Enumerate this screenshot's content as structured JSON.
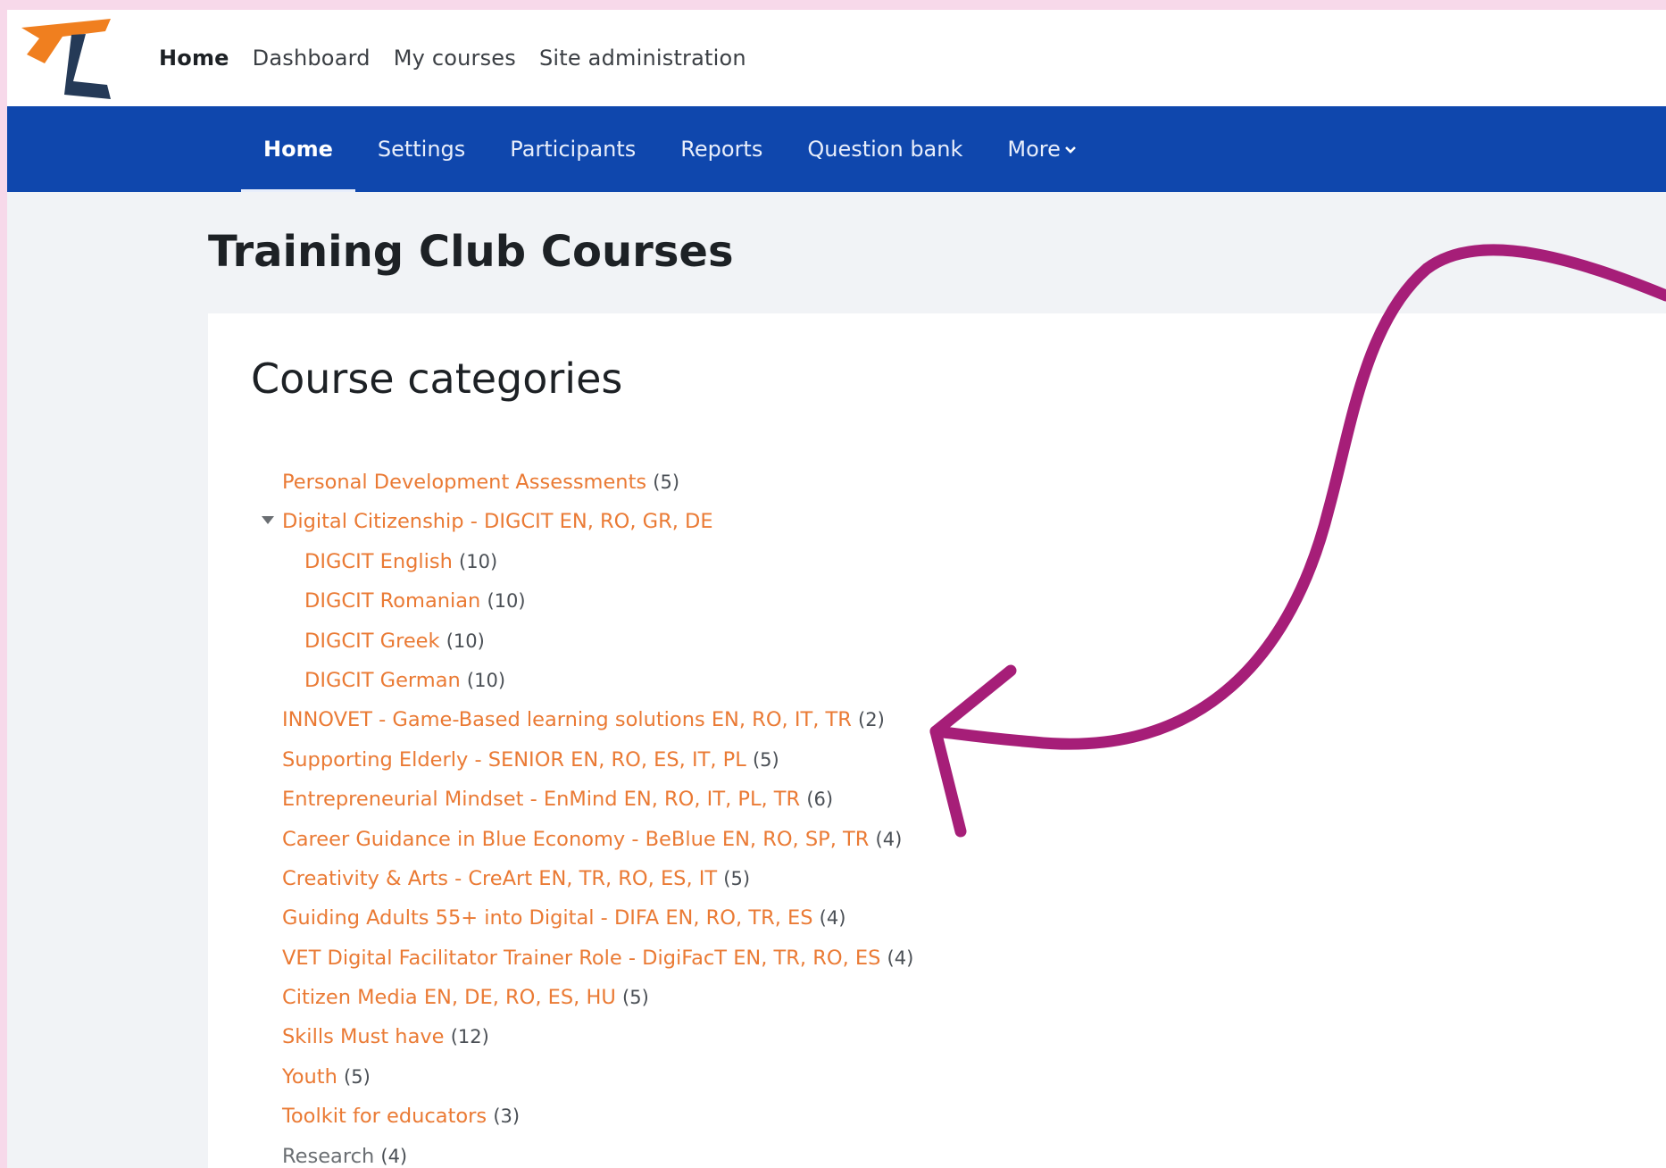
{
  "colors": {
    "primary": "#0f47ad",
    "link": "#ea7a34",
    "logo_orange": "#f07f1f",
    "logo_navy": "#253a57",
    "annotation_arrow": "#a61e78"
  },
  "topnav": {
    "items": [
      {
        "label": "Home",
        "active": true
      },
      {
        "label": "Dashboard"
      },
      {
        "label": "My courses"
      },
      {
        "label": "Site administration"
      }
    ]
  },
  "secondary_nav": {
    "items": [
      {
        "label": "Home",
        "active": true
      },
      {
        "label": "Settings"
      },
      {
        "label": "Participants"
      },
      {
        "label": "Reports"
      },
      {
        "label": "Question bank"
      },
      {
        "label": "More",
        "icon": "chevron-down-icon"
      }
    ]
  },
  "page": {
    "title": "Training Club Courses"
  },
  "course_categories": {
    "heading": "Course categories",
    "items": [
      {
        "name": "Personal Development Assessments",
        "count": "(5)"
      },
      {
        "name": "Digital Citizenship - DIGCIT EN, RO, GR, DE",
        "count": "",
        "expanded": true
      },
      {
        "name": "DIGCIT English",
        "count": "(10)"
      },
      {
        "name": "DIGCIT Romanian",
        "count": "(10)"
      },
      {
        "name": "DIGCIT Greek",
        "count": "(10)"
      },
      {
        "name": "DIGCIT German",
        "count": "(10)"
      },
      {
        "name": "INNOVET - Game-Based learning solutions EN, RO, IT, TR",
        "count": "(2)"
      },
      {
        "name": "Supporting Elderly - SENIOR EN, RO, ES, IT, PL",
        "count": "(5)"
      },
      {
        "name": "Entrepreneurial Mindset - EnMind EN, RO, IT, PL, TR",
        "count": "(6)"
      },
      {
        "name": "Career Guidance in Blue Economy - BeBlue EN, RO, SP, TR",
        "count": "(4)"
      },
      {
        "name": "Creativity & Arts - CreArt EN, TR, RO, ES, IT",
        "count": "(5)"
      },
      {
        "name": "Guiding Adults 55+ into Digital - DIFA EN, RO, TR, ES",
        "count": "(4)"
      },
      {
        "name": "VET Digital Facilitator Trainer Role - DigiFacT EN, TR, RO, ES",
        "count": "(4)"
      },
      {
        "name": "Citizen Media EN, DE, RO, ES, HU",
        "count": "(5)"
      },
      {
        "name": "Skills Must have",
        "count": "(12)"
      },
      {
        "name": "Youth",
        "count": "(5)"
      },
      {
        "name": "Toolkit for educators",
        "count": "(3)"
      },
      {
        "name": "Research",
        "count": "(4)"
      }
    ]
  }
}
